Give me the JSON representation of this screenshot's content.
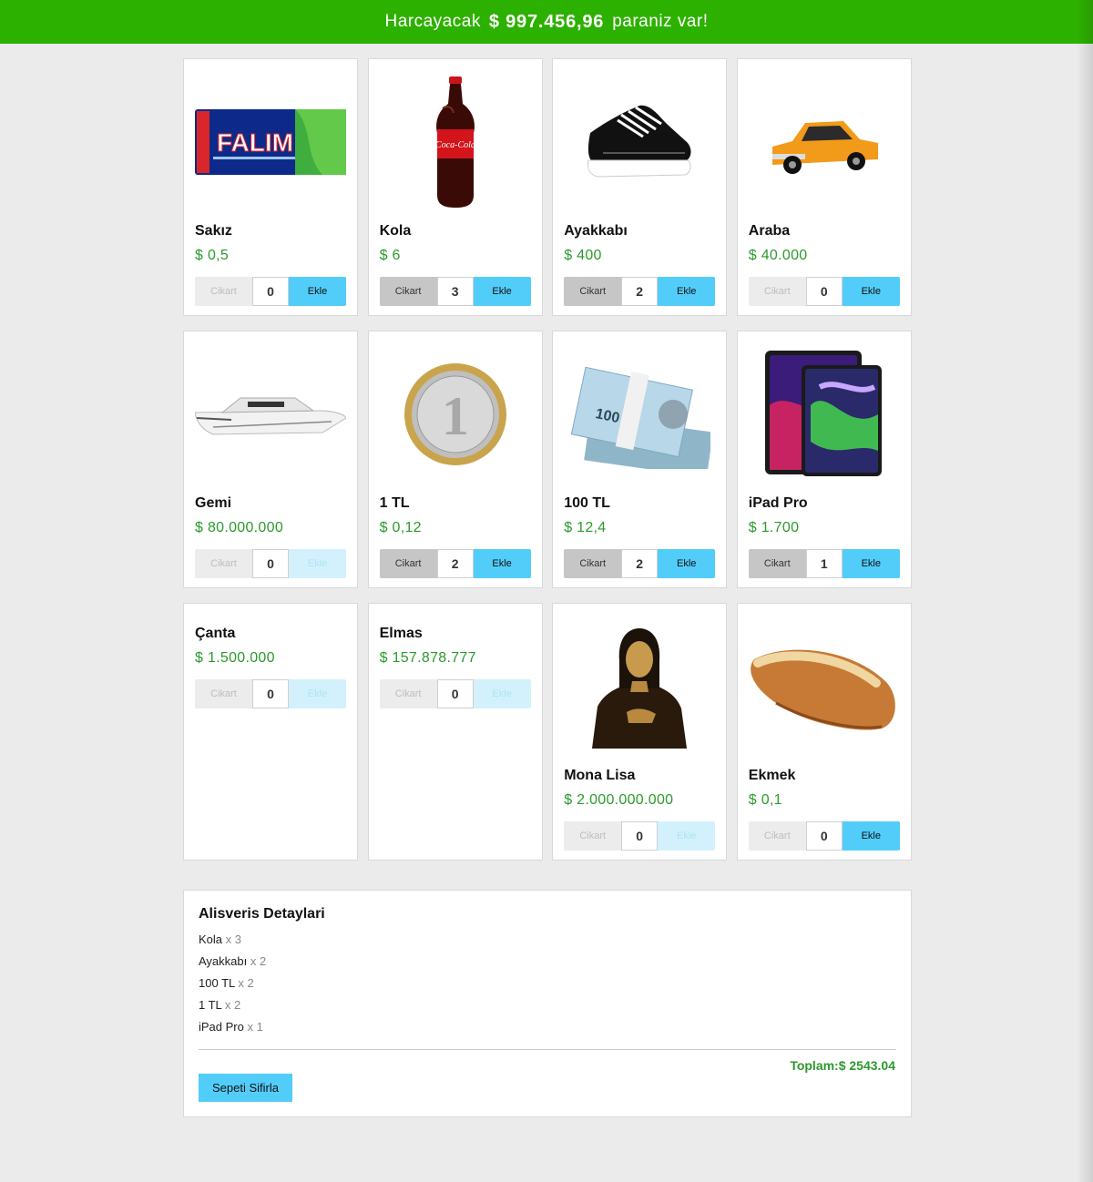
{
  "header": {
    "prefix": "Harcayacak",
    "money": "$ 997.456,96",
    "suffix": "paraniz var!"
  },
  "controls_labels": {
    "remove": "Cikart",
    "add": "Ekle"
  },
  "products": [
    {
      "name": "Sakız",
      "price": "$ 0,5",
      "qty": "0",
      "image": "gum-pack",
      "remove_disabled": true,
      "add_disabled": false
    },
    {
      "name": "Kola",
      "price": "$ 6",
      "qty": "3",
      "image": "cola-bottle",
      "remove_disabled": false,
      "add_disabled": false
    },
    {
      "name": "Ayakkabı",
      "price": "$ 400",
      "qty": "2",
      "image": "sneaker",
      "remove_disabled": false,
      "add_disabled": false
    },
    {
      "name": "Araba",
      "price": "$ 40.000",
      "qty": "0",
      "image": "orange-car",
      "remove_disabled": true,
      "add_disabled": false
    },
    {
      "name": "Gemi",
      "price": "$ 80.000.000",
      "qty": "0",
      "image": "yacht",
      "remove_disabled": true,
      "add_disabled": true
    },
    {
      "name": "1 TL",
      "price": "$ 0,12",
      "qty": "2",
      "image": "coin",
      "remove_disabled": false,
      "add_disabled": false
    },
    {
      "name": "100 TL",
      "price": "$ 12,4",
      "qty": "2",
      "image": "banknotes",
      "remove_disabled": false,
      "add_disabled": false
    },
    {
      "name": "iPad Pro",
      "price": "$ 1.700",
      "qty": "1",
      "image": "tablets",
      "remove_disabled": false,
      "add_disabled": false
    },
    {
      "name": "Çanta",
      "price": "$ 1.500.000",
      "qty": "0",
      "image": null,
      "remove_disabled": true,
      "add_disabled": true
    },
    {
      "name": "Elmas",
      "price": "$ 157.878.777",
      "qty": "0",
      "image": null,
      "remove_disabled": true,
      "add_disabled": true
    },
    {
      "name": "Mona Lisa",
      "price": "$ 2.000.000.000",
      "qty": "0",
      "image": "mona-lisa",
      "remove_disabled": true,
      "add_disabled": true
    },
    {
      "name": "Ekmek",
      "price": "$ 0,1",
      "qty": "0",
      "image": "bread",
      "remove_disabled": true,
      "add_disabled": false
    }
  ],
  "summary": {
    "title": "Alisveris Detaylari",
    "items": [
      {
        "name": "Kola",
        "qty": "x 3"
      },
      {
        "name": "Ayakkabı",
        "qty": "x 2"
      },
      {
        "name": "100 TL",
        "qty": "x 2"
      },
      {
        "name": "1 TL",
        "qty": "x 2"
      },
      {
        "name": "iPad Pro",
        "qty": "x 1"
      }
    ],
    "total": "Toplam:$ 2543.04",
    "reset_label": "Sepeti Sifirla"
  },
  "colors": {
    "header_bg": "#2db100",
    "price": "#2c9a2c",
    "add_button": "#52cdf9"
  }
}
